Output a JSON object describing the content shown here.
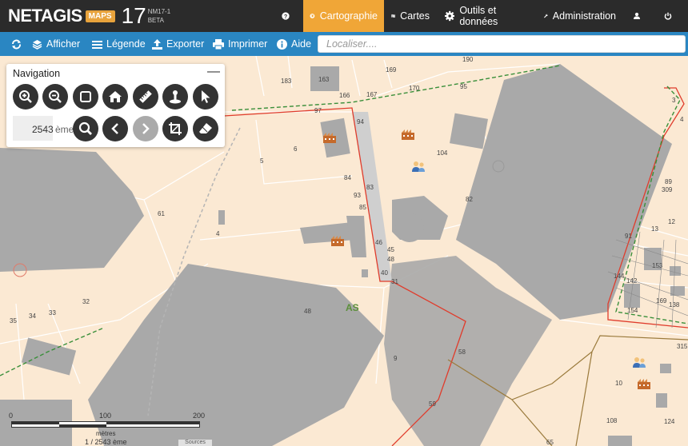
{
  "app": {
    "logo_text": "NETAGIS",
    "logo_badge": "MAPS",
    "logo_number": "17",
    "version_line1": "NM17-1",
    "version_line2": "BETA"
  },
  "topnav": {
    "help_icon": "question-circle-icon",
    "items": [
      {
        "label": "Cartographie",
        "icon": "globe-icon",
        "active": true
      },
      {
        "label": "Cartes",
        "icon": "map-icon",
        "active": false
      },
      {
        "label": "Outils et données",
        "icon": "gear-icon",
        "active": false
      },
      {
        "label": "Administration",
        "icon": "wrench-icon",
        "active": false
      }
    ],
    "user_icon": "user-icon",
    "power_icon": "power-icon"
  },
  "toolbar": {
    "refresh_icon": "refresh-icon",
    "items": [
      {
        "label": "Afficher",
        "icon": "layers-icon"
      },
      {
        "label": "Légende",
        "icon": "list-icon"
      },
      {
        "label": "Exporter",
        "icon": "upload-icon"
      },
      {
        "label": "Imprimer",
        "icon": "print-icon"
      },
      {
        "label": "Aide",
        "icon": "info-circle-icon"
      }
    ],
    "search_placeholder": "Localiser...."
  },
  "navigation": {
    "title": "Navigation",
    "minimize": "—",
    "scale_value": "2543",
    "scale_unit": "ème",
    "buttons_row1": [
      "zoom-in-icon",
      "zoom-out-icon",
      "square-icon",
      "home-icon",
      "ruler-icon",
      "pin-icon",
      "pointer-icon"
    ],
    "buttons_row2": [
      "zoom-search-icon",
      "previous-icon",
      "next-icon",
      "crop-icon",
      "eraser-icon"
    ]
  },
  "scalebar": {
    "ticks": [
      "0",
      "100",
      "200"
    ],
    "unit": "mètres",
    "ratio": "1 / 2543 ème",
    "sources": "Sources"
  },
  "map": {
    "parcel_labels": [
      "183",
      "163",
      "190",
      "169",
      "170",
      "166",
      "167",
      "95",
      "97",
      "94",
      "104",
      "6",
      "5",
      "84",
      "93",
      "83",
      "85",
      "82",
      "61",
      "4",
      "46",
      "45",
      "48",
      "40",
      "31",
      "AS",
      "48",
      "9",
      "58",
      "32",
      "33",
      "34",
      "35",
      "59",
      "108",
      "65",
      "10",
      "3",
      "4",
      "89",
      "309",
      "12",
      "13",
      "91",
      "153",
      "144",
      "142",
      "169",
      "138",
      "154",
      "315",
      "124"
    ],
    "colors": {
      "background": "#fbe9d3",
      "building": "#a9a9a9",
      "parcel_line": "#ffffff",
      "boundary_red": "#e03c2c",
      "boundary_green": "#3a8f3a",
      "boundary_brown": "#9a7a3c",
      "topbar": "#2b2b2b",
      "active": "#f0a637",
      "toolbar": "#2a86c2"
    }
  }
}
